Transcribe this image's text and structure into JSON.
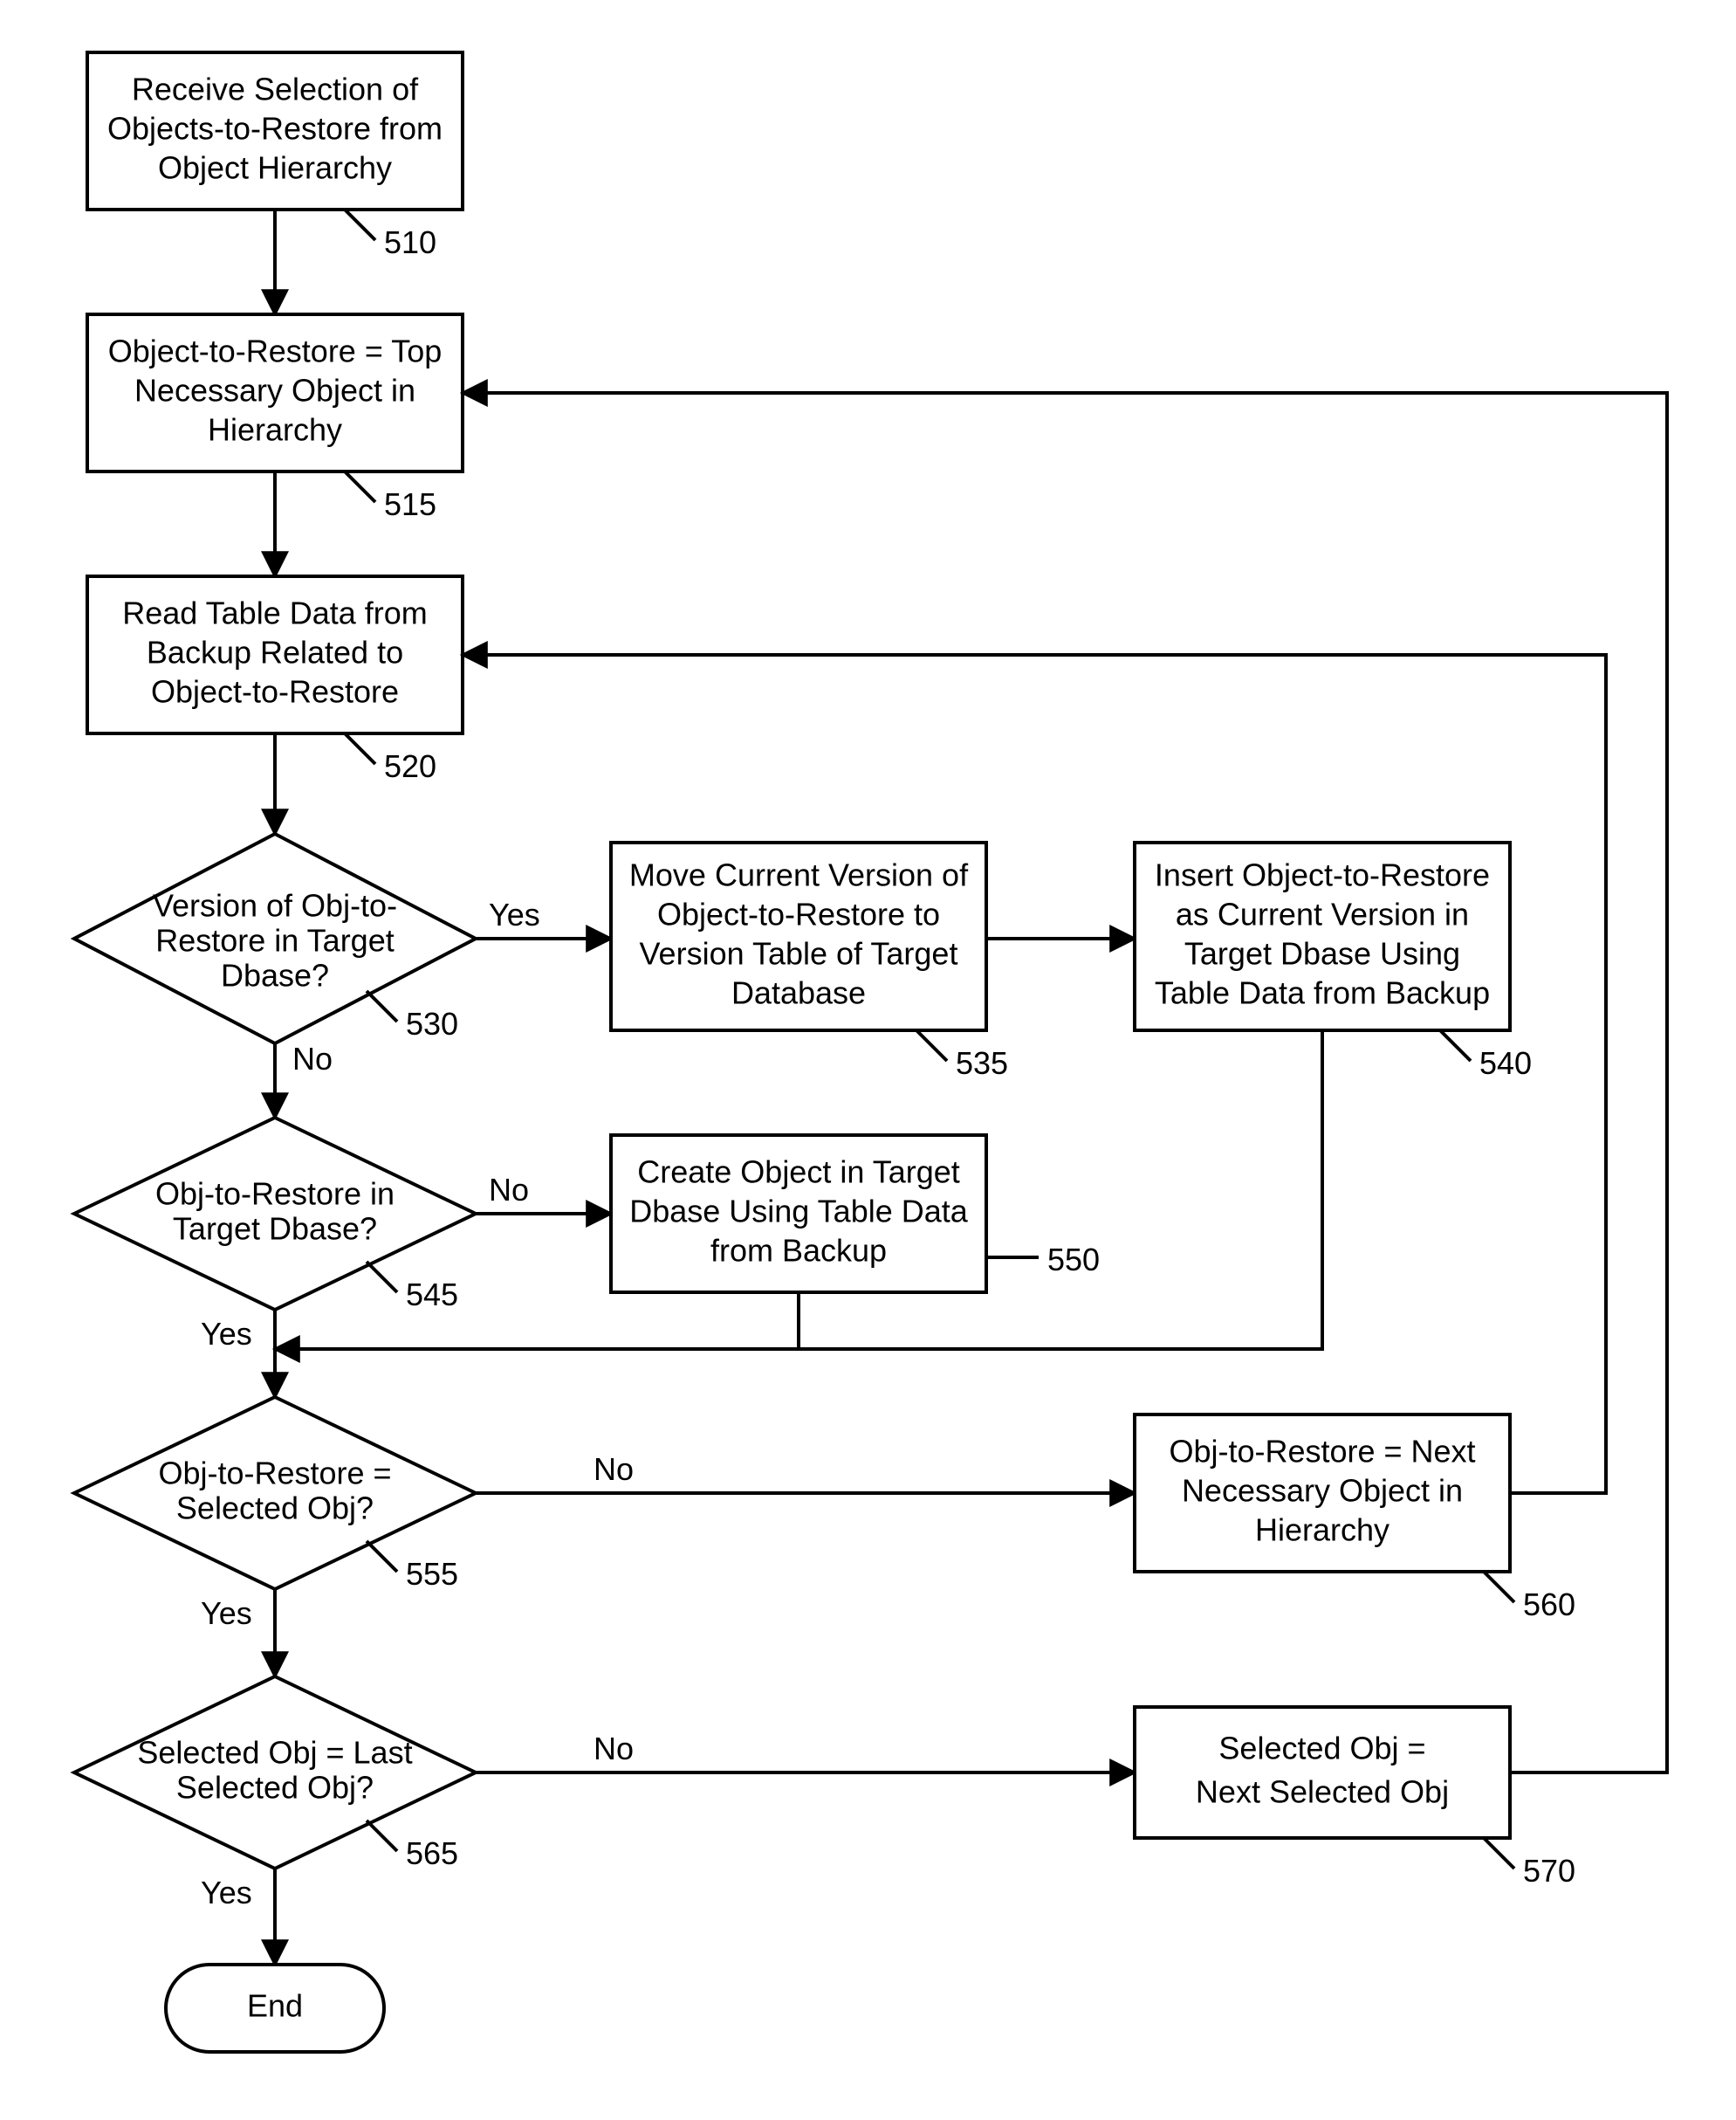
{
  "flow": {
    "n510": {
      "l1": "Receive Selection of",
      "l2": "Objects-to-Restore from",
      "l3": "Object Hierarchy",
      "ref": "510"
    },
    "n515": {
      "l1": "Object-to-Restore = Top",
      "l2": "Necessary Object in",
      "l3": "Hierarchy",
      "ref": "515"
    },
    "n520": {
      "l1": "Read Table Data from",
      "l2": "Backup Related to",
      "l3": "Object-to-Restore",
      "ref": "520"
    },
    "n530": {
      "l1": "Version of Obj-to-",
      "l2": "Restore in Target",
      "l3": "Dbase?",
      "ref": "530"
    },
    "n535": {
      "l1": "Move Current Version of",
      "l2": "Object-to-Restore to",
      "l3": "Version Table of Target",
      "l4": "Database",
      "ref": "535"
    },
    "n540": {
      "l1": "Insert Object-to-Restore",
      "l2": "as Current Version in",
      "l3": "Target Dbase Using",
      "l4": "Table Data from Backup",
      "ref": "540"
    },
    "n545": {
      "l1": "Obj-to-Restore in",
      "l2": "Target Dbase?",
      "ref": "545"
    },
    "n550": {
      "l1": "Create Object in Target",
      "l2": "Dbase Using Table Data",
      "l3": "from Backup",
      "ref": "550"
    },
    "n555": {
      "l1": "Obj-to-Restore =",
      "l2": "Selected Obj?",
      "ref": "555"
    },
    "n560": {
      "l1": "Obj-to-Restore = Next",
      "l2": "Necessary Object in",
      "l3": "Hierarchy",
      "ref": "560"
    },
    "n565": {
      "l1": "Selected Obj = Last",
      "l2": "Selected Obj?",
      "ref": "565"
    },
    "n570": {
      "l1": "Selected Obj =",
      "l2": "Next Selected Obj",
      "ref": "570"
    },
    "end": {
      "label": "End"
    }
  },
  "edges": {
    "yes": "Yes",
    "no": "No"
  }
}
